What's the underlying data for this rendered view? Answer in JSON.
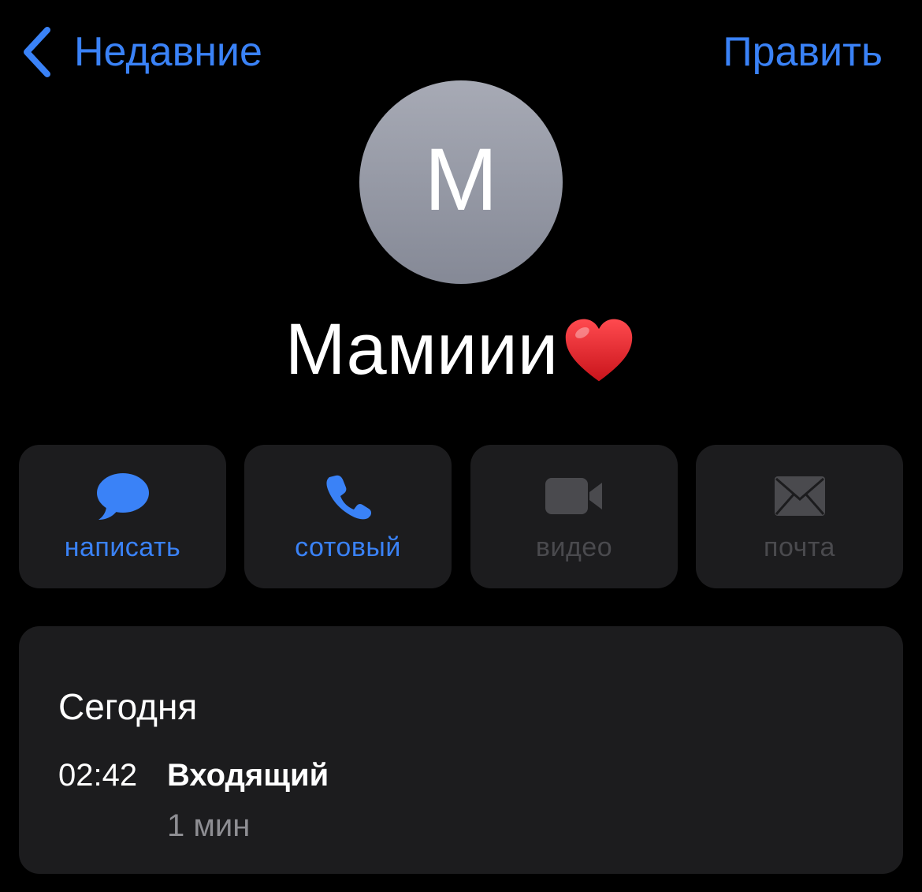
{
  "nav": {
    "back_label": "Недавние",
    "edit_label": "Править"
  },
  "contact": {
    "initial": "М",
    "name": "Мамиии",
    "name_emoji": "red-heart"
  },
  "actions": [
    {
      "label": "написать",
      "icon": "message-bubble-icon",
      "enabled": true
    },
    {
      "label": "сотовый",
      "icon": "phone-icon",
      "enabled": true
    },
    {
      "label": "видео",
      "icon": "video-camera-icon",
      "enabled": false
    },
    {
      "label": "почта",
      "icon": "envelope-icon",
      "enabled": false
    }
  ],
  "call_history": {
    "date": "Сегодня",
    "entries": [
      {
        "time": "02:42",
        "type": "Входящий",
        "duration": "1 мин"
      }
    ]
  },
  "colors": {
    "background": "#000000",
    "accent": "#3a82f7",
    "card": "#1c1c1e",
    "disabled": "#4a4a4e",
    "secondary_text": "#8e8e93",
    "avatar_top": "#a7aab5",
    "avatar_bottom": "#858996",
    "heart": "#e0262a"
  }
}
